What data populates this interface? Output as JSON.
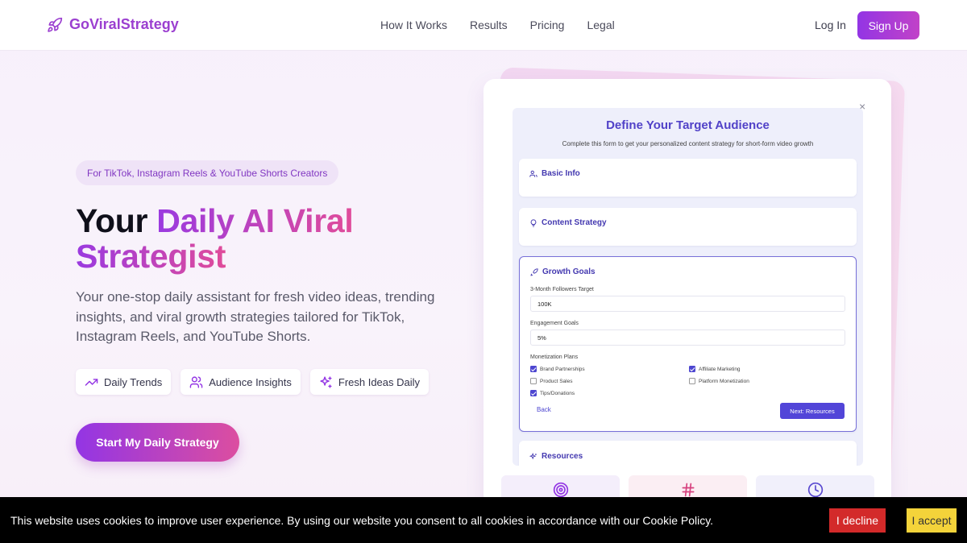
{
  "nav": {
    "logo_text": "GoViralStrategy",
    "links": [
      "How It Works",
      "Results",
      "Pricing",
      "Legal"
    ],
    "login": "Log In",
    "signup": "Sign Up"
  },
  "hero": {
    "badge": "For TikTok, Instagram Reels & YouTube Shorts Creators",
    "headline_plain": "Your",
    "headline_grad_1": "Daily AI Viral",
    "headline_grad_2": "Strategist",
    "subtext": "Your one-stop daily assistant for fresh video ideas, trending insights, and viral growth strategies tailored for TikTok, Instagram Reels, and YouTube Shorts.",
    "chips": [
      {
        "label": "Daily Trends",
        "icon": "trending-up-icon"
      },
      {
        "label": "Audience Insights",
        "icon": "users-icon"
      },
      {
        "label": "Fresh Ideas Daily",
        "icon": "sparkles-icon"
      }
    ],
    "cta": "Start My Daily Strategy"
  },
  "form": {
    "title": "Define Your Target Audience",
    "description": "Complete this form to get your personalized content strategy for short-form video growth",
    "sections": {
      "basic": "Basic Info",
      "content": "Content Strategy",
      "growth": "Growth Goals",
      "resources": "Resources"
    },
    "followers_label": "3-Month Followers Target",
    "followers_value": "100K",
    "engagement_label": "Engagement Goals",
    "engagement_value": "5%",
    "monetization_label": "Monetization Plans",
    "options": [
      {
        "label": "Brand Partnerships",
        "checked": true
      },
      {
        "label": "Affiliate Marketing",
        "checked": true
      },
      {
        "label": "Product Sales",
        "checked": false
      },
      {
        "label": "Platform Monetization",
        "checked": false
      },
      {
        "label": "Tips/Donations",
        "checked": true
      }
    ],
    "back": "Back",
    "next": "Next: Resources",
    "close": "×"
  },
  "cookie": {
    "text": "This website uses cookies to improve user experience. By using our website you consent to all cookies in accordance with our Cookie Policy.",
    "decline": "I decline",
    "accept": "I accept"
  },
  "colors": {
    "brand_purple": "#9335e4",
    "brand_pink": "#dc4ea0",
    "form_accent": "#5245d8",
    "decline_red": "#d32a2a",
    "accept_yellow": "#f4d33a"
  }
}
